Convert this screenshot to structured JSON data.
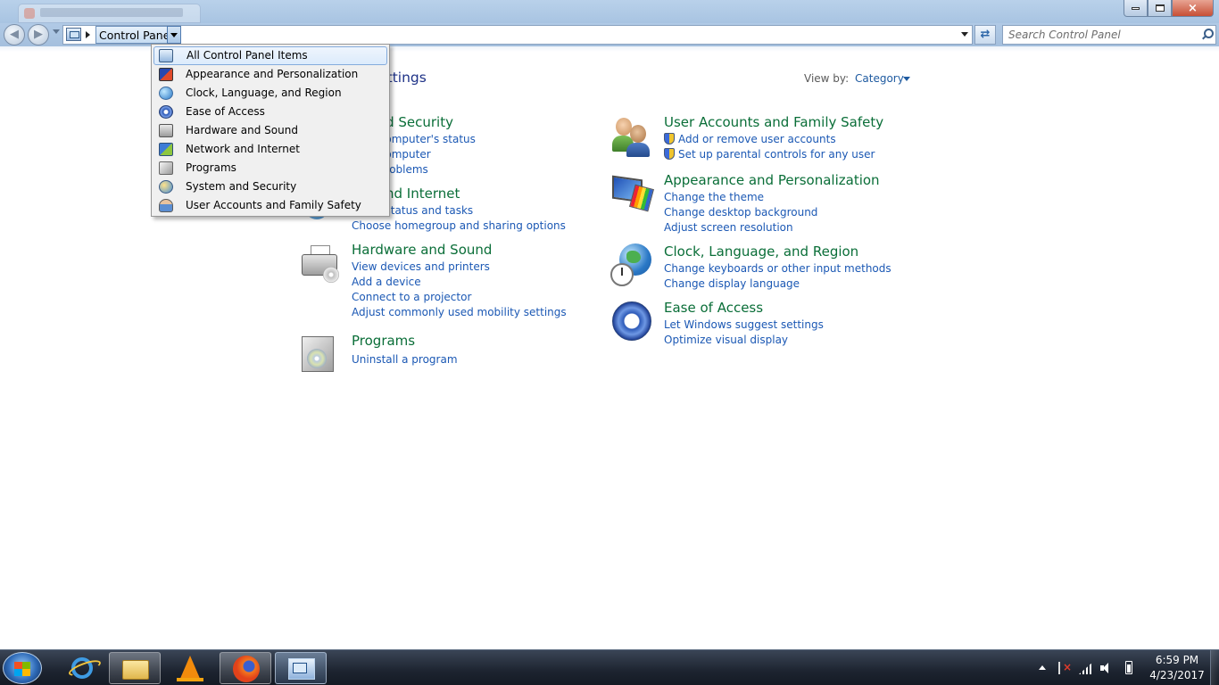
{
  "window": {
    "close_label": "×"
  },
  "address_bar": {
    "crumb": "Control Panel"
  },
  "search": {
    "placeholder": "Search Control Panel"
  },
  "main": {
    "heading_partial": "mputer's settings",
    "view_by_label": "View by:",
    "view_by_value": "Category"
  },
  "categories": {
    "system": {
      "title": "m and Security",
      "links": [
        "your computer's status",
        "your computer",
        "d fix problems"
      ]
    },
    "network": {
      "title": "ork and Internet",
      "links": [
        "twork status and tasks",
        "Choose homegroup and sharing options"
      ]
    },
    "hardware": {
      "title": "Hardware and Sound",
      "links": [
        "View devices and printers",
        "Add a device",
        "Connect to a projector",
        "Adjust commonly used mobility settings"
      ]
    },
    "programs": {
      "title": "Programs",
      "links": [
        "Uninstall a program"
      ]
    },
    "users": {
      "title": "User Accounts and Family Safety",
      "links": [
        "Add or remove user accounts",
        "Set up parental controls for any user"
      ]
    },
    "appearance": {
      "title": "Appearance and Personalization",
      "links": [
        "Change the theme",
        "Change desktop background",
        "Adjust screen resolution"
      ]
    },
    "clock": {
      "title": "Clock, Language, and Region",
      "links": [
        "Change keyboards or other input methods",
        "Change display language"
      ]
    },
    "ease": {
      "title": "Ease of Access",
      "links": [
        "Let Windows suggest settings",
        "Optimize visual display"
      ]
    }
  },
  "dropdown": {
    "items": [
      {
        "label": "All Control Panel Items",
        "icon": "control-panel-icon"
      },
      {
        "label": "Appearance and Personalization",
        "icon": "appearance-icon"
      },
      {
        "label": "Clock, Language, and Region",
        "icon": "clock-globe-icon"
      },
      {
        "label": "Ease of Access",
        "icon": "ease-of-access-icon"
      },
      {
        "label": "Hardware and Sound",
        "icon": "printer-icon"
      },
      {
        "label": "Network and Internet",
        "icon": "network-icon"
      },
      {
        "label": "Programs",
        "icon": "programs-icon"
      },
      {
        "label": "System and Security",
        "icon": "system-security-icon"
      },
      {
        "label": "User Accounts and Family Safety",
        "icon": "users-icon"
      }
    ]
  },
  "taskbar": {
    "time": "6:59 PM",
    "date": "4/23/2017"
  },
  "colors": {
    "category_title": "#0a6e38",
    "link": "#1b58b4",
    "heading": "#1e3287",
    "taskbar": "#1d2430"
  }
}
